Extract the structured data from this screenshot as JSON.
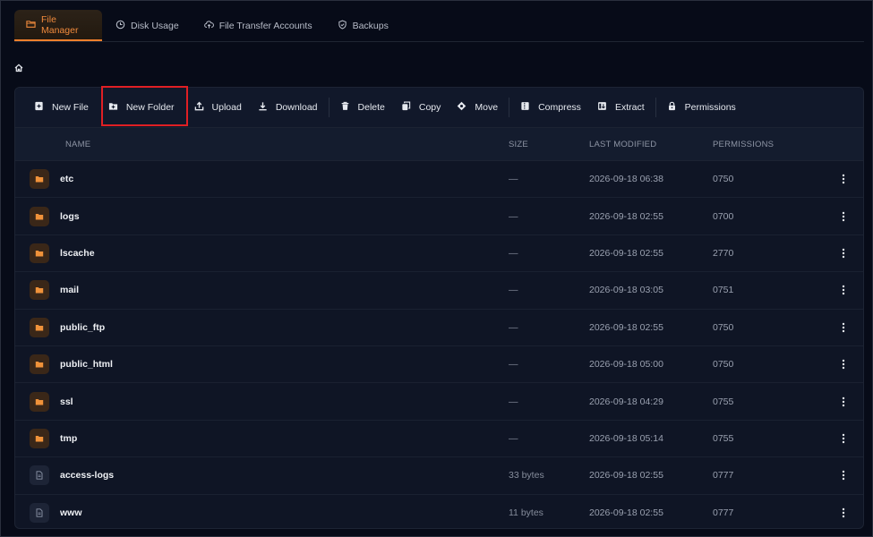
{
  "tabs": [
    {
      "label": "File Manager",
      "icon": "folder-icon",
      "active": true
    },
    {
      "label": "Disk Usage",
      "icon": "clock-icon",
      "active": false
    },
    {
      "label": "File Transfer Accounts",
      "icon": "cloud-upload-icon",
      "active": false
    },
    {
      "label": "Backups",
      "icon": "shield-icon",
      "active": false
    }
  ],
  "breadcrumb": {
    "icon": "home-icon"
  },
  "toolbar": {
    "new_file": "New File",
    "new_folder": "New Folder",
    "upload": "Upload",
    "download": "Download",
    "delete": "Delete",
    "copy": "Copy",
    "move": "Move",
    "compress": "Compress",
    "extract": "Extract",
    "permissions": "Permissions"
  },
  "columns": {
    "name": "NAME",
    "size": "SIZE",
    "modified": "LAST MODIFIED",
    "permissions": "PERMISSIONS"
  },
  "files": [
    {
      "type": "folder",
      "name": "etc",
      "size": "—",
      "modified": "2026-09-18 06:38",
      "permissions": "0750"
    },
    {
      "type": "folder",
      "name": "logs",
      "size": "—",
      "modified": "2026-09-18 02:55",
      "permissions": "0700"
    },
    {
      "type": "folder",
      "name": "lscache",
      "size": "—",
      "modified": "2026-09-18 02:55",
      "permissions": "2770"
    },
    {
      "type": "folder",
      "name": "mail",
      "size": "—",
      "modified": "2026-09-18 03:05",
      "permissions": "0751"
    },
    {
      "type": "folder",
      "name": "public_ftp",
      "size": "—",
      "modified": "2026-09-18 02:55",
      "permissions": "0750"
    },
    {
      "type": "folder",
      "name": "public_html",
      "size": "—",
      "modified": "2026-09-18 05:00",
      "permissions": "0750"
    },
    {
      "type": "folder",
      "name": "ssl",
      "size": "—",
      "modified": "2026-09-18 04:29",
      "permissions": "0755"
    },
    {
      "type": "folder",
      "name": "tmp",
      "size": "—",
      "modified": "2026-09-18 05:14",
      "permissions": "0755"
    },
    {
      "type": "file",
      "name": "access-logs",
      "size": "33 bytes",
      "modified": "2026-09-18 02:55",
      "permissions": "0777"
    },
    {
      "type": "file",
      "name": "www",
      "size": "11 bytes",
      "modified": "2026-09-18 02:55",
      "permissions": "0777"
    }
  ],
  "colors": {
    "accent": "#f07f2c",
    "background": "#070b18",
    "panel": "#0f1525",
    "highlight": "#e01f24"
  }
}
